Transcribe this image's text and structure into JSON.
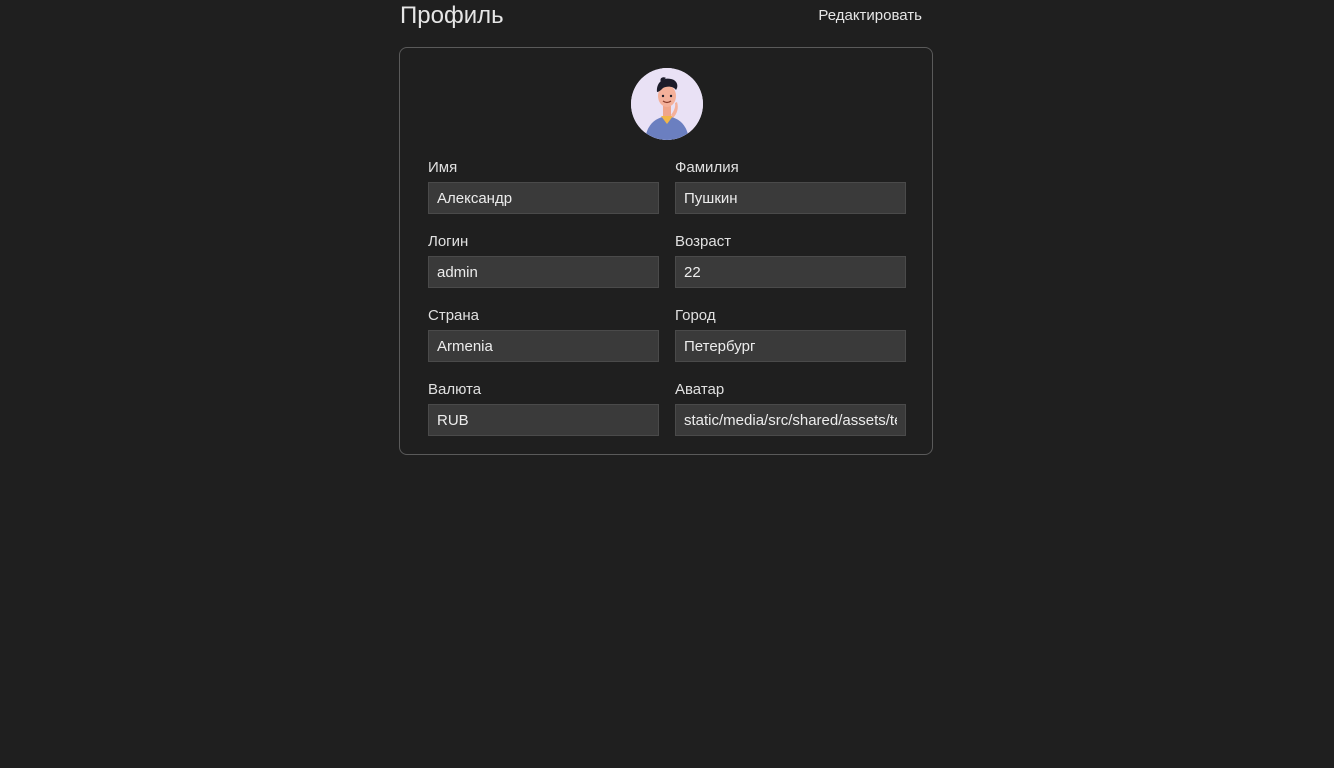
{
  "header": {
    "title": "Профиль",
    "edit_label": "Редактировать"
  },
  "profile": {
    "first_name": {
      "label": "Имя",
      "value": "Александр"
    },
    "last_name": {
      "label": "Фамилия",
      "value": "Пушкин"
    },
    "username": {
      "label": "Логин",
      "value": "admin"
    },
    "age": {
      "label": "Возраст",
      "value": "22"
    },
    "country": {
      "label": "Страна",
      "value": "Armenia"
    },
    "city": {
      "label": "Город",
      "value": "Петербург"
    },
    "currency": {
      "label": "Валюта",
      "value": "RUB"
    },
    "avatar_url": {
      "label": "Аватар",
      "value": "static/media/src/shared/assets/te"
    }
  },
  "colors": {
    "background": "#1f1f1f",
    "input_background": "#3a3a3a",
    "card_border": "#5a5a5a",
    "avatar_background": "#e9e1f5",
    "avatar_shirt": "#6b7fc0"
  }
}
